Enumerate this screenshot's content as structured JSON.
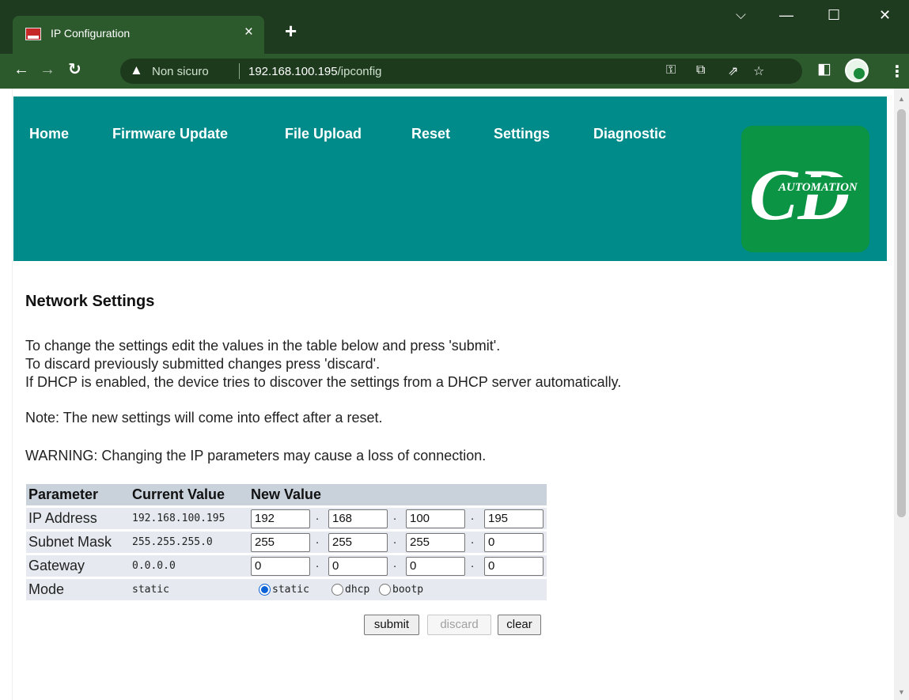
{
  "browser": {
    "tab_title": "IP Configuration",
    "tab_close": "×",
    "new_tab": "+",
    "window_controls": {
      "dropdown": "⌵",
      "minimize": "—",
      "maximize": "☐",
      "close": "✕"
    },
    "insecure_label": "Non sicuro",
    "url_host": "192.168.100.195",
    "url_path": "/ipconfig",
    "toolbar_icons": [
      "key-icon",
      "translate-icon",
      "share-icon",
      "bookmark-star-icon",
      "sidepanel-icon",
      "profile-icon",
      "menu-icon"
    ]
  },
  "nav": {
    "items": [
      {
        "label": "Home"
      },
      {
        "label": "Firmware Update"
      },
      {
        "label": "File Upload"
      },
      {
        "label": "Reset"
      },
      {
        "label": "Settings"
      },
      {
        "label": "Diagnostic"
      }
    ]
  },
  "logo": {
    "letters": "CD",
    "subtitle": "AUTOMATION"
  },
  "content": {
    "heading": "Network Settings",
    "intro_line1": "To change the settings edit the values in the table below and press 'submit'.",
    "intro_line2": "To discard previously submitted changes press 'discard'.",
    "intro_line3": "If DHCP is enabled, the device tries to discover the settings from a DHCP server automatically.",
    "note": "Note: The new settings will come into effect after a reset.",
    "warning": "WARNING: Changing the IP parameters may cause a loss of connection."
  },
  "table": {
    "headers": [
      "Parameter",
      "Current Value",
      "New Value"
    ],
    "rows": [
      {
        "param": "IP Address",
        "current": "192.168.100.195",
        "octets": [
          "192",
          "168",
          "100",
          "195"
        ]
      },
      {
        "param": "Subnet Mask",
        "current": "255.255.255.0",
        "octets": [
          "255",
          "255",
          "255",
          "0"
        ]
      },
      {
        "param": "Gateway",
        "current": "0.0.0.0",
        "octets": [
          "0",
          "0",
          "0",
          "0"
        ]
      }
    ],
    "mode": {
      "param": "Mode",
      "current": "static",
      "options": [
        "static",
        "dhcp",
        "bootp"
      ],
      "selected": "static"
    },
    "octet_separator": "."
  },
  "buttons": {
    "submit": "submit",
    "discard": "discard",
    "clear": "clear"
  },
  "colors": {
    "browser_frame": "#1f3b1f",
    "header_band": "#008b8b",
    "logo_bg": "#0a9444",
    "table_header": "#c9d2db",
    "table_row": "#e6eaf0"
  }
}
